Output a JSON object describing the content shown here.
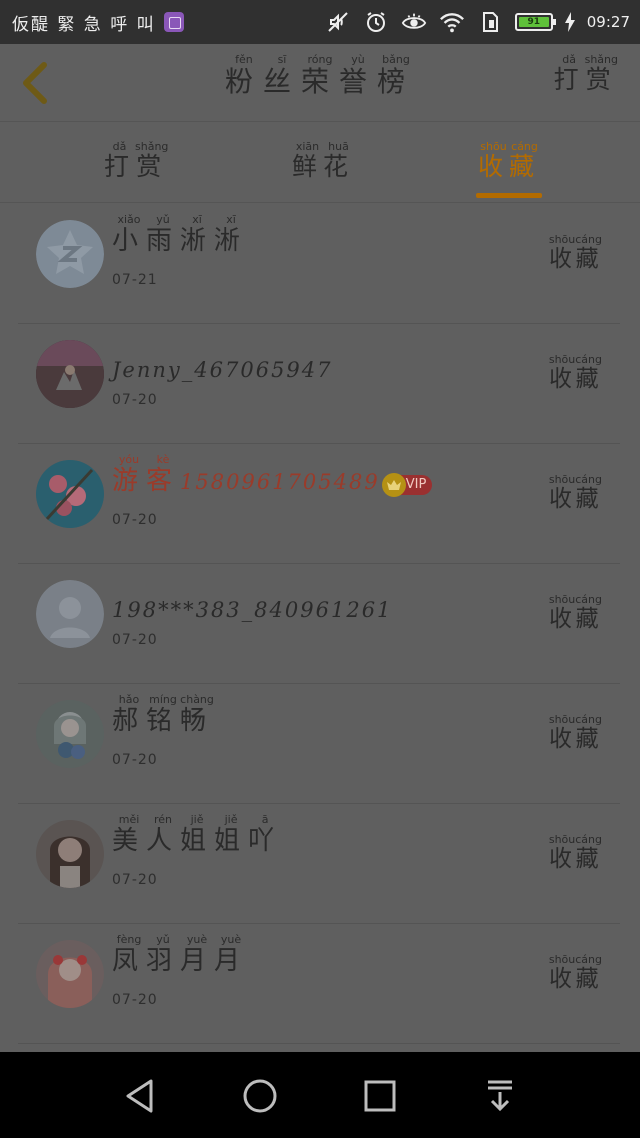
{
  "status_bar": {
    "left_text": "仮醍 緊 急 呼 叫",
    "battery_level": "91",
    "time": "09:27",
    "icons": [
      "app-thumbnail-icon",
      "mute-icon",
      "alarm-icon",
      "eye-comfort-icon",
      "wifi-icon",
      "sim-icon",
      "battery-icon",
      "charging-icon"
    ]
  },
  "header": {
    "back_icon": "chevron-left-icon",
    "title": [
      {
        "han": "粉",
        "py": "fěn"
      },
      {
        "han": "丝",
        "py": "sī"
      },
      {
        "han": "荣",
        "py": "róng"
      },
      {
        "han": "誉",
        "py": "yù"
      },
      {
        "han": "榜",
        "py": "bǎng"
      }
    ],
    "reward": [
      {
        "han": "打",
        "py": "dǎ"
      },
      {
        "han": "赏",
        "py": "shǎng"
      }
    ]
  },
  "tabs": [
    {
      "chars": [
        {
          "han": "打",
          "py": "dǎ"
        },
        {
          "han": "赏",
          "py": "shǎng"
        }
      ],
      "active": false
    },
    {
      "chars": [
        {
          "han": "鲜",
          "py": "xiān"
        },
        {
          "han": "花",
          "py": "huā"
        }
      ],
      "active": false
    },
    {
      "chars": [
        {
          "han": "收",
          "py": "shōu"
        },
        {
          "han": "藏",
          "py": "cáng"
        }
      ],
      "active": true
    }
  ],
  "colors": {
    "accent": "#b36b00",
    "vip_name": "#9a3b2a",
    "overlay_bg": "#5f5f5f"
  },
  "list": [
    {
      "name_chars": [
        {
          "han": "小",
          "py": "xiǎo"
        },
        {
          "han": "雨",
          "py": "yǔ"
        },
        {
          "han": "淅",
          "py": "xī"
        },
        {
          "han": "淅",
          "py": "xī"
        }
      ],
      "name_latin": "",
      "date": "07-21",
      "vip": false,
      "avatar": "qq-default-avatar-icon",
      "action": [
        {
          "han": "收",
          "py": "shōu"
        },
        {
          "han": "藏",
          "py": "cáng"
        }
      ]
    },
    {
      "name_chars": [],
      "name_latin": "Jenny_467065947",
      "date": "07-20",
      "vip": false,
      "avatar": "field-photo-avatar",
      "action": [
        {
          "han": "收",
          "py": "shōu"
        },
        {
          "han": "藏",
          "py": "cáng"
        }
      ]
    },
    {
      "name_chars": [
        {
          "han": "游",
          "py": "yóu"
        },
        {
          "han": "客",
          "py": "kè"
        }
      ],
      "name_latin": "15809617054​89",
      "date": "07-20",
      "vip": true,
      "vip_label": "VIP",
      "avatar": "flower-photo-avatar",
      "action": [
        {
          "han": "收",
          "py": "shōu"
        },
        {
          "han": "藏",
          "py": "cáng"
        }
      ]
    },
    {
      "name_chars": [],
      "name_latin": "198***383_840961261",
      "date": "07-20",
      "vip": false,
      "avatar": "default-person-avatar-icon",
      "action": [
        {
          "han": "收",
          "py": "shōu"
        },
        {
          "han": "藏",
          "py": "cáng"
        }
      ]
    },
    {
      "name_chars": [
        {
          "han": "郝",
          "py": "hǎo"
        },
        {
          "han": "铭",
          "py": "míng"
        },
        {
          "han": "畅",
          "py": "chàng"
        }
      ],
      "name_latin": "",
      "date": "07-20",
      "vip": false,
      "avatar": "anime-girl-avatar",
      "action": [
        {
          "han": "收",
          "py": "shōu"
        },
        {
          "han": "藏",
          "py": "cáng"
        }
      ]
    },
    {
      "name_chars": [
        {
          "han": "美",
          "py": "měi"
        },
        {
          "han": "人",
          "py": "rén"
        },
        {
          "han": "姐",
          "py": "jiě"
        },
        {
          "han": "姐",
          "py": "jiě"
        },
        {
          "han": "吖",
          "py": "ā"
        }
      ],
      "name_latin": "",
      "date": "07-20",
      "vip": false,
      "avatar": "girl-portrait-avatar",
      "action": [
        {
          "han": "收",
          "py": "shōu"
        },
        {
          "han": "藏",
          "py": "cáng"
        }
      ]
    },
    {
      "name_chars": [
        {
          "han": "凤",
          "py": "fèng"
        },
        {
          "han": "羽",
          "py": "yǔ"
        },
        {
          "han": "月",
          "py": "yuè"
        },
        {
          "han": "月",
          "py": "yuè"
        }
      ],
      "name_latin": "",
      "date": "07-20",
      "vip": false,
      "avatar": "pink-anime-avatar",
      "action": [
        {
          "han": "收",
          "py": "shōu"
        },
        {
          "han": "藏",
          "py": "cáng"
        }
      ]
    }
  ],
  "nav_bar": {
    "buttons": [
      "back-triangle-icon",
      "home-circle-icon",
      "recents-square-icon",
      "notification-pull-icon"
    ]
  }
}
